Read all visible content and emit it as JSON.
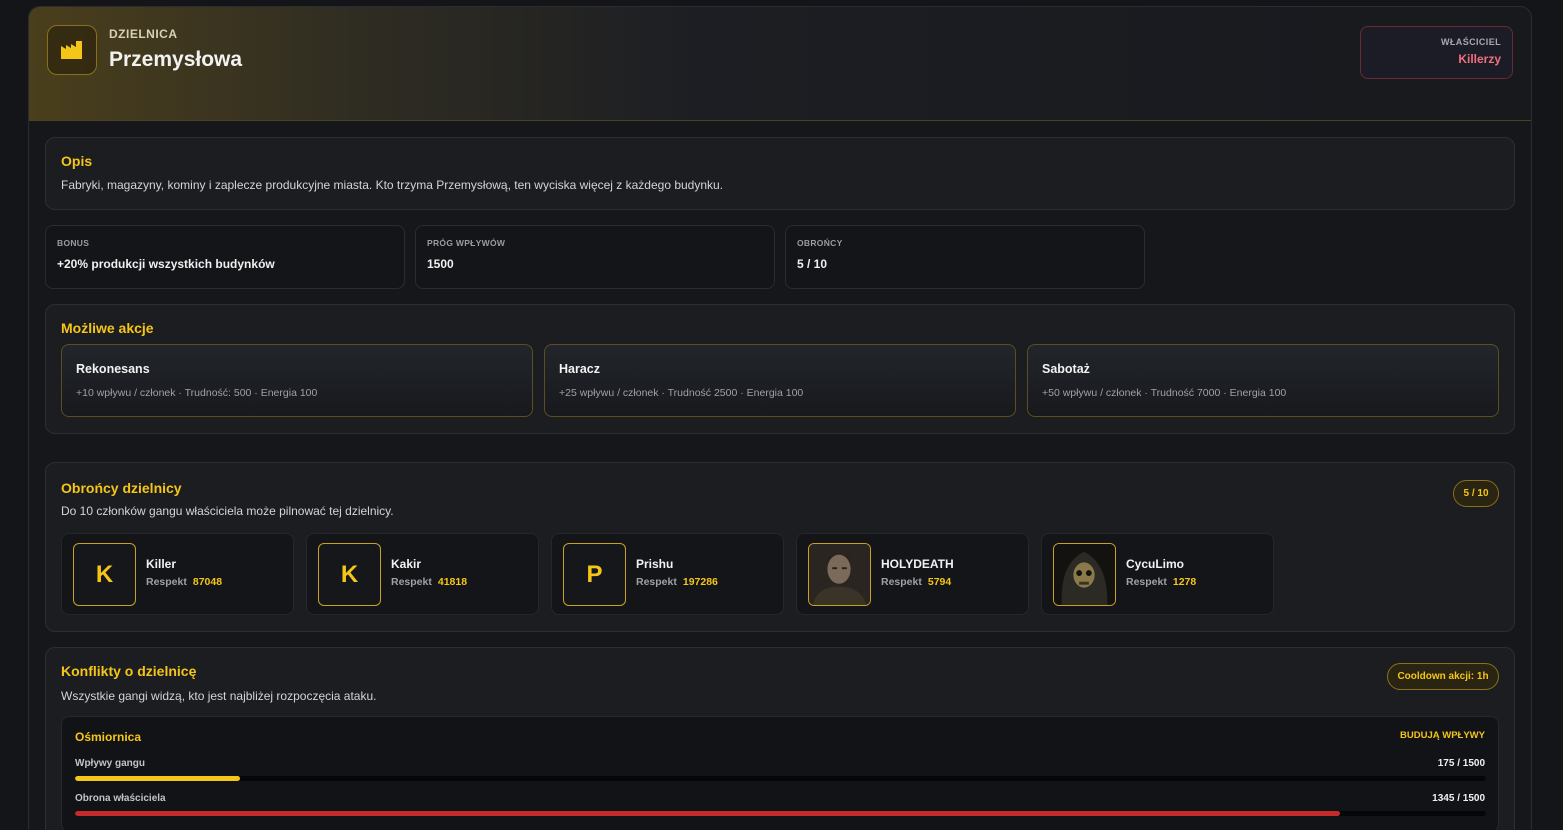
{
  "header": {
    "label": "DZIELNICA",
    "title": "Przemysłowa",
    "icon": "factory-icon",
    "owner_label": "WŁAŚCICIEL",
    "owner_name": "Killerzy"
  },
  "description": {
    "title": "Opis",
    "text": "Fabryki, magazyny, kominy i zaplecze produkcyjne miasta. Kto trzyma Przemysłową, ten wyciska więcej z każdego budynku."
  },
  "stats": [
    {
      "label": "BONUS",
      "value": "+20% produkcji wszystkich budynków"
    },
    {
      "label": "PRÓG WPŁYWÓW",
      "value": "1500"
    },
    {
      "label": "OBROŃCY",
      "value": "5 / 10"
    }
  ],
  "actions": {
    "title": "Możliwe akcje",
    "items": [
      {
        "name": "Rekonesans",
        "desc": "+10 wpływu / członek · Trudność: 500 · Energia 100"
      },
      {
        "name": "Haracz",
        "desc": "+25 wpływu / członek · Trudność 2500 · Energia 100"
      },
      {
        "name": "Sabotaż",
        "desc": "+50 wpływu / członek · Trudność 7000 · Energia 100"
      }
    ]
  },
  "defenders": {
    "title": "Obrońcy dzielnicy",
    "subtitle": "Do 10 członków gangu właściciela może pilnować tej dzielnicy.",
    "count": "5 / 10",
    "respekt_label": "Respekt",
    "members": [
      {
        "initial": "K",
        "name": "Killer",
        "respekt": "87048",
        "photo": false
      },
      {
        "initial": "K",
        "name": "Kakir",
        "respekt": "41818",
        "photo": false
      },
      {
        "initial": "P",
        "name": "Prishu",
        "respekt": "197286",
        "photo": false
      },
      {
        "initial": "",
        "name": "HOLYDEATH",
        "respekt": "5794",
        "photo": true,
        "avatar_icon": "portrait-man-icon"
      },
      {
        "initial": "",
        "name": "CycuLimo",
        "respekt": "1278",
        "photo": true,
        "avatar_icon": "hooded-skull-icon"
      }
    ]
  },
  "conflicts": {
    "title": "Konflikty o dzielnicę",
    "subtitle": "Wszystkie gangi widzą, kto jest najbliżej rozpoczęcia ataku.",
    "cooldown": "Cooldown akcji: 1h",
    "items": [
      {
        "gang": "Ośmiornica",
        "status": "BUDUJĄ WPŁYWY",
        "influence_label": "Wpływy gangu",
        "influence_value": "175 / 1500",
        "influence_fraction": 0.1167,
        "defense_label": "Obrona właściciela",
        "defense_value": "1345 / 1500",
        "defense_fraction": 0.8967
      }
    ]
  },
  "colors": {
    "accent": "#f5c518",
    "owner": "#f07080",
    "defense_bar": "#c42a2a",
    "background": "#141518"
  }
}
